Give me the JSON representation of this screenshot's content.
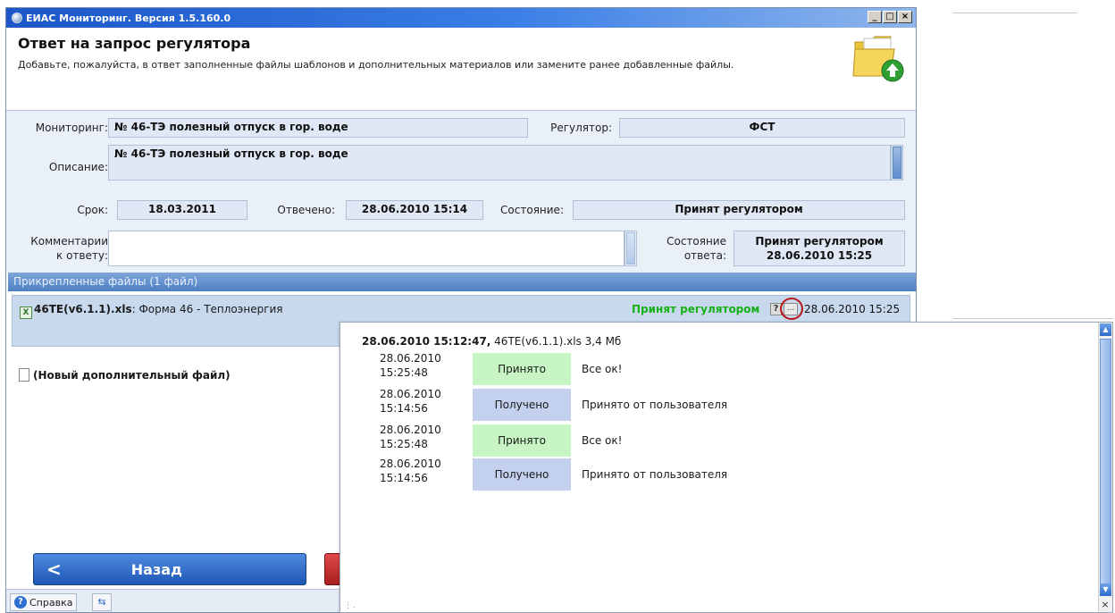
{
  "window": {
    "title": "ЕИАС Мониторинг. Версия 1.5.160.0",
    "buttons": [
      "_",
      "□",
      "×"
    ]
  },
  "header": {
    "title": "Ответ на запрос регулятора",
    "subtitle": "Добавьте, пожалуйста, в ответ заполненные файлы шаблонов и дополнительных материалов или замените ранее добавленные файлы."
  },
  "form": {
    "monitoring_label": "Мониторинг:",
    "monitoring_value": "№ 46-ТЭ полезный отпуск в гор. воде",
    "regulator_label": "Регулятор:",
    "regulator_value": "ФСТ",
    "description_label": "Описание:",
    "description_value": "№ 46-ТЭ полезный отпуск в гор. воде",
    "deadline_label": "Срок:",
    "deadline_value": "18.03.2011",
    "answered_label": "Отвечено:",
    "answered_value": "28.06.2010 15:14",
    "state_label": "Состояние:",
    "state_value": "Принят регулятором",
    "comment_label_1": "Комментарии",
    "comment_label_2": "к ответу:",
    "comment_value": "",
    "answer_state_label_1": "Состояние",
    "answer_state_label_2": "ответа:",
    "answer_state_value_1": "Принят регулятором",
    "answer_state_value_2": "28.06.2010 15:25"
  },
  "files": {
    "header": "Прикрепленные файлы (1 файл)",
    "items": [
      {
        "icon": "excel-file-icon",
        "name": "46TE(v6.1.1).xls",
        "description": ": Форма 46 - Теплоэнергия",
        "status": "Принят регулятором",
        "help_label": "?",
        "more_label": "...",
        "date": "28.06.2010 15:25"
      }
    ],
    "new_file_label": "(Новый дополнительный файл)"
  },
  "footer": {
    "back_label": "Назад",
    "back_arrow": "<",
    "help_label": "Справка",
    "help_icon_glyph": "?",
    "swap_glyph": "⇆"
  },
  "popup": {
    "head_bold": "28.06.2010 15:12:47,",
    "head_rest": " 46TE(v6.1.1).xls 3,4 Мб",
    "close_glyph": "×",
    "rows": [
      {
        "date": "28.06.2010",
        "time": "15:25:48",
        "status": "Принято",
        "status_color": "#c7f5c3",
        "comment": "Все ок!"
      },
      {
        "date": "28.06.2010",
        "time": "15:14:56",
        "status": "Получено",
        "status_color": "#c3d0ee",
        "comment": "Принято от пользователя"
      },
      {
        "date": "28.06.2010",
        "time": "15:25:48",
        "status": "Принято",
        "status_color": "#c7f5c3",
        "comment": "Все ок!"
      },
      {
        "date": "28.06.2010",
        "time": "15:14:56",
        "status": "Получено",
        "status_color": "#c3d0ee",
        "comment": "Принято от пользователя"
      }
    ]
  },
  "colors": {
    "accepted_green": "#18b018",
    "titlebar_blue": "#1c56c7",
    "highlight_red": "#b81818"
  }
}
